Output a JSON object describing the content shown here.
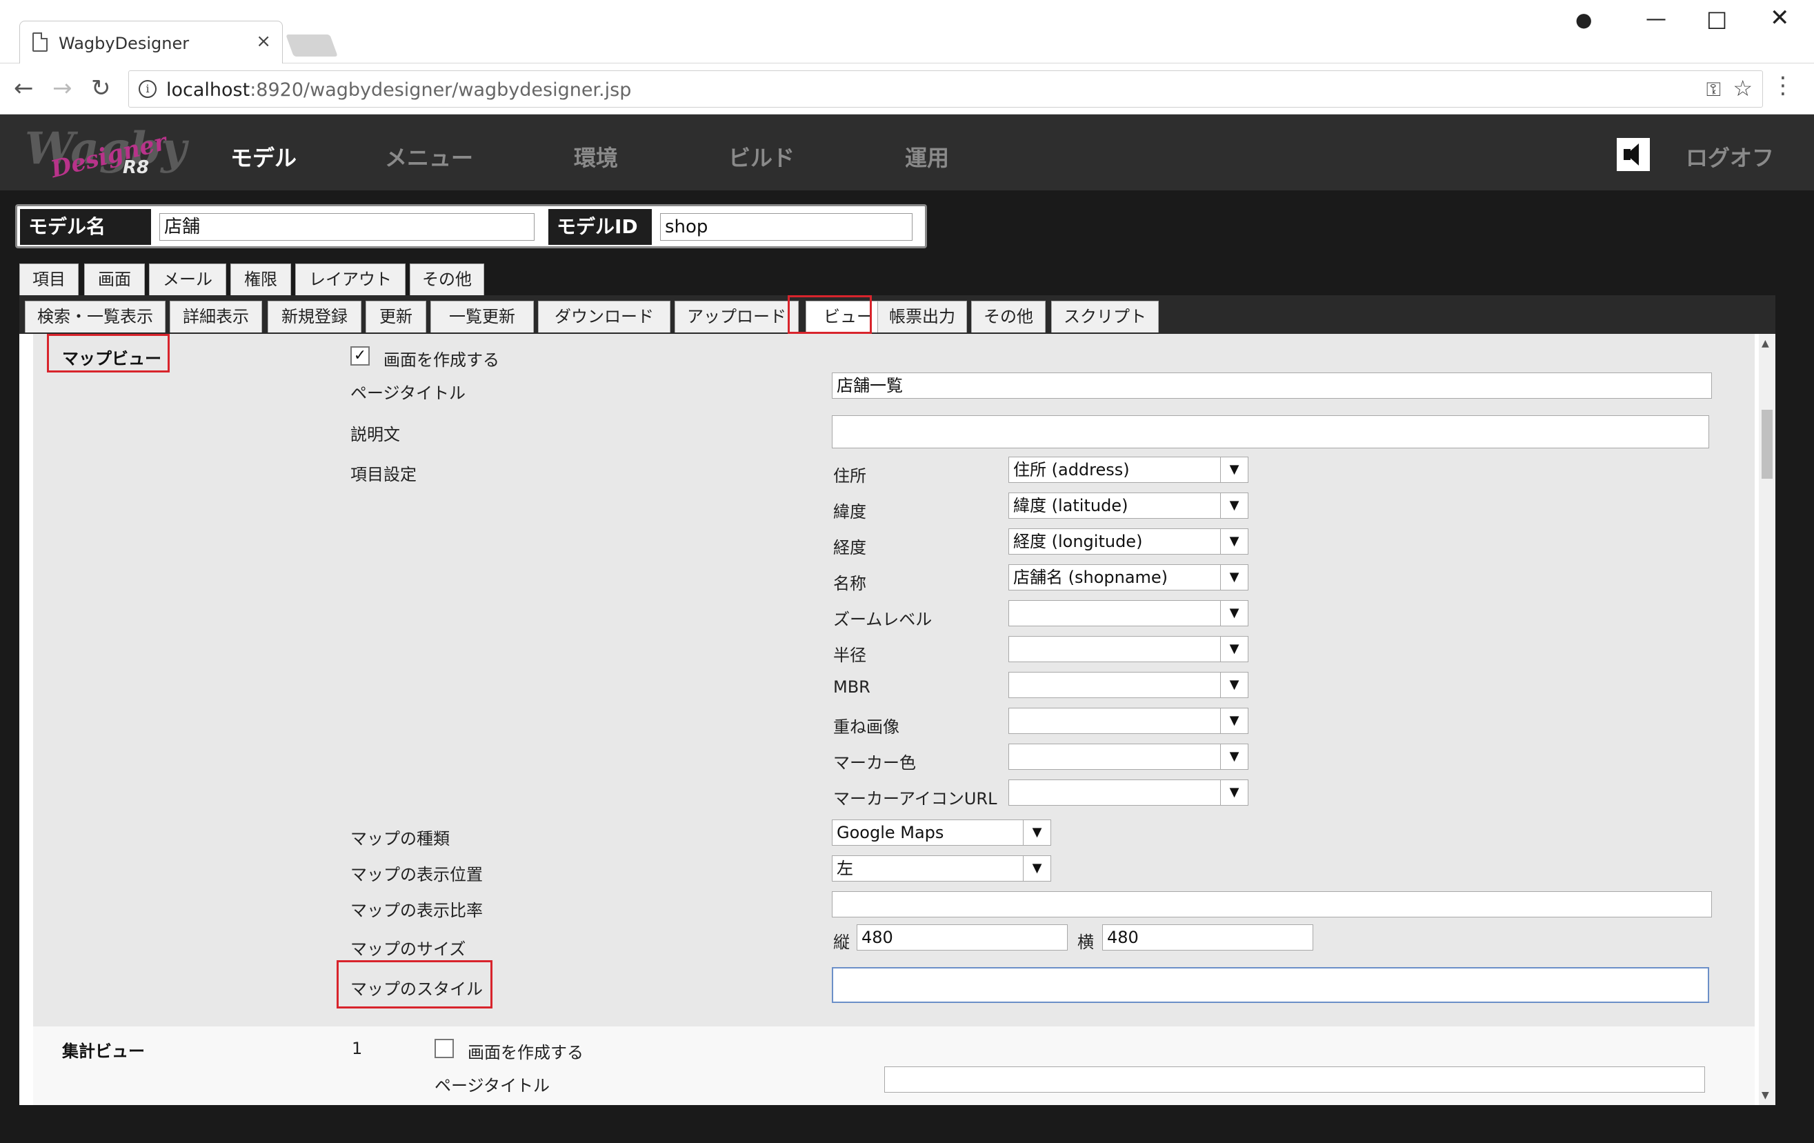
{
  "browser": {
    "tab_title": "WagbyDesigner",
    "url_host": "localhost",
    "url_rest": ":8920/wagbydesigner/wagbydesigner.jsp"
  },
  "app": {
    "logo_text": "Wagby",
    "logo_script": "Designer",
    "logo_version": "R8",
    "nav": [
      "モデル",
      "メニュー",
      "環境",
      "ビルド",
      "運用"
    ],
    "logoff": "ログオフ"
  },
  "model": {
    "name_label": "モデル名",
    "name_value": "店舗",
    "id_label": "モデルID",
    "id_value": "shop"
  },
  "tabs_primary": [
    "項目",
    "画面",
    "メール",
    "権限",
    "レイアウト",
    "その他"
  ],
  "tabs_secondary": [
    "検索・一覧表示",
    "詳細表示",
    "新規登録",
    "更新",
    "一覧更新",
    "ダウンロード",
    "アップロード",
    "ビュー",
    "帳票出力",
    "その他",
    "スクリプト"
  ],
  "mapview": {
    "title": "マップビュー",
    "create_checkbox_label": "画面を作成する",
    "create_checked": true,
    "page_title_label": "ページタイトル",
    "page_title_value": "店舗一覧",
    "description_label": "説明文",
    "description_value": "",
    "item_settings_label": "項目設定",
    "items": [
      {
        "label": "住所",
        "value": "住所 (address)"
      },
      {
        "label": "緯度",
        "value": "緯度 (latitude)"
      },
      {
        "label": "経度",
        "value": "経度 (longitude)"
      },
      {
        "label": "名称",
        "value": "店舗名 (shopname)"
      },
      {
        "label": "ズームレベル",
        "value": ""
      },
      {
        "label": "半径",
        "value": ""
      },
      {
        "label": "MBR",
        "value": ""
      },
      {
        "label": "重ね画像",
        "value": ""
      },
      {
        "label": "マーカー色",
        "value": ""
      },
      {
        "label": "マーカーアイコンURL",
        "value": ""
      }
    ],
    "map_type_label": "マップの種類",
    "map_type_value": "Google Maps",
    "map_position_label": "マップの表示位置",
    "map_position_value": "左",
    "map_ratio_label": "マップの表示比率",
    "map_ratio_value": "",
    "map_size_label": "マップのサイズ",
    "map_height_label": "縦",
    "map_height_value": "480",
    "map_width_label": "横",
    "map_width_value": "480",
    "map_style_label": "マップのスタイル",
    "map_style_value": ""
  },
  "summaryview": {
    "title": "集計ビュー",
    "index": "1",
    "create_checkbox_label": "画面を作成する",
    "page_title_label": "ページタイトル",
    "page_title_value": ""
  },
  "colors": {
    "highlight": "#d8242c",
    "nav_bg": "#2e2e2e",
    "panel_bg": "#e8e8e8"
  }
}
